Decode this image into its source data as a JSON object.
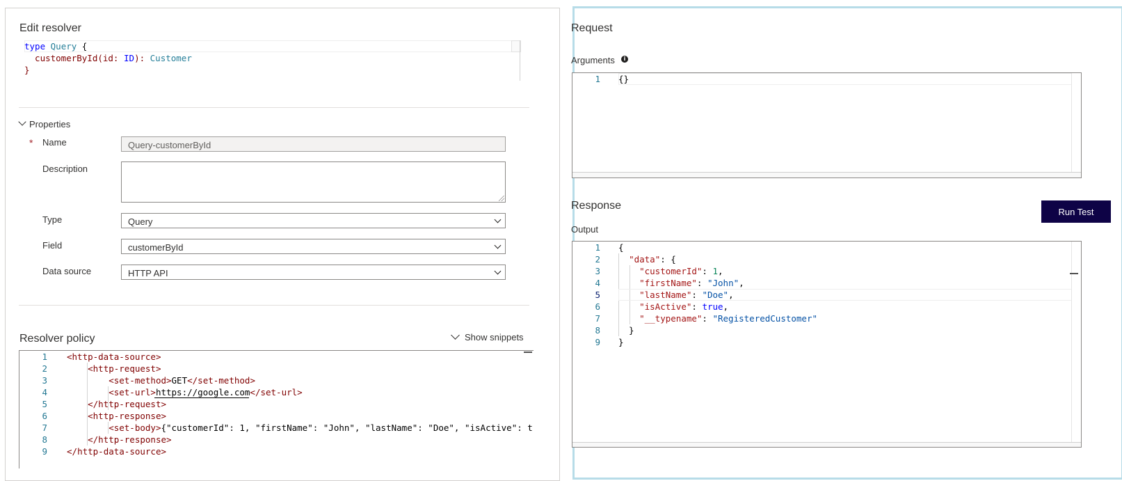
{
  "edit_resolver": {
    "title": "Edit resolver",
    "schema_lines": [
      [
        {
          "t": "type",
          "c": "kw"
        },
        {
          "t": " ",
          "c": "plain"
        },
        {
          "t": "Query",
          "c": "typ"
        },
        {
          "t": " {",
          "c": "plain"
        }
      ],
      [
        {
          "t": "  customerById(id: ",
          "c": "tag"
        },
        {
          "t": "ID",
          "c": "kw"
        },
        {
          "t": "): ",
          "c": "tag"
        },
        {
          "t": "Customer",
          "c": "typ"
        }
      ],
      [
        {
          "t": "}",
          "c": "tag"
        }
      ]
    ]
  },
  "properties": {
    "header": "Properties",
    "required_mark": "*",
    "name_label": "Name",
    "name_value": "Query-customerById",
    "description_label": "Description",
    "description_value": "",
    "type_label": "Type",
    "type_value": "Query",
    "field_label": "Field",
    "field_value": "customerById",
    "data_source_label": "Data source",
    "data_source_value": "HTTP API"
  },
  "resolver_policy": {
    "title": "Resolver policy",
    "show_snippets_label": "Show snippets",
    "lines": [
      {
        "n": "1",
        "tokens": [
          {
            "t": "<",
            "c": "tag"
          },
          {
            "t": "http-data-source",
            "c": "tag"
          },
          {
            "t": ">",
            "c": "tag"
          }
        ]
      },
      {
        "n": "2",
        "tokens": [
          {
            "t": "    <",
            "c": "tag"
          },
          {
            "t": "http-request",
            "c": "tag"
          },
          {
            "t": ">",
            "c": "tag"
          }
        ]
      },
      {
        "n": "3",
        "tokens": [
          {
            "t": "        <",
            "c": "tag"
          },
          {
            "t": "set-method",
            "c": "tag"
          },
          {
            "t": ">",
            "c": "tag"
          },
          {
            "t": "GET",
            "c": "plain"
          },
          {
            "t": "</",
            "c": "tag"
          },
          {
            "t": "set-method",
            "c": "tag"
          },
          {
            "t": ">",
            "c": "tag"
          }
        ]
      },
      {
        "n": "4",
        "tokens": [
          {
            "t": "        <",
            "c": "tag"
          },
          {
            "t": "set-url",
            "c": "tag"
          },
          {
            "t": ">",
            "c": "tag"
          },
          {
            "t": "https://google.com",
            "c": "plain"
          },
          {
            "t": "</",
            "c": "tag"
          },
          {
            "t": "set-url",
            "c": "tag"
          },
          {
            "t": ">",
            "c": "tag"
          }
        ]
      },
      {
        "n": "5",
        "tokens": [
          {
            "t": "    </",
            "c": "tag"
          },
          {
            "t": "http-request",
            "c": "tag"
          },
          {
            "t": ">",
            "c": "tag"
          }
        ]
      },
      {
        "n": "6",
        "tokens": [
          {
            "t": "    <",
            "c": "tag"
          },
          {
            "t": "http-response",
            "c": "tag"
          },
          {
            "t": ">",
            "c": "tag"
          }
        ]
      },
      {
        "n": "7",
        "tokens": [
          {
            "t": "        <",
            "c": "tag"
          },
          {
            "t": "set-body",
            "c": "tag"
          },
          {
            "t": ">",
            "c": "tag"
          },
          {
            "t": "{\"customerId\": 1, \"firstName\": \"John\", \"lastName\": \"Doe\", \"isActive\": tr",
            "c": "plain"
          }
        ]
      },
      {
        "n": "8",
        "tokens": [
          {
            "t": "    </",
            "c": "tag"
          },
          {
            "t": "http-response",
            "c": "tag"
          },
          {
            "t": ">",
            "c": "tag"
          }
        ]
      },
      {
        "n": "9",
        "tokens": [
          {
            "t": "</",
            "c": "tag"
          },
          {
            "t": "http-data-source",
            "c": "tag"
          },
          {
            "t": ">",
            "c": "tag"
          }
        ]
      }
    ]
  },
  "request": {
    "title": "Request",
    "arguments_label": "Arguments",
    "info_glyph": "i",
    "lines": [
      {
        "n": "1",
        "tokens": [
          {
            "t": "{}",
            "c": "plain"
          }
        ]
      }
    ]
  },
  "response": {
    "title": "Response",
    "run_test_label": "Run Test",
    "output_label": "Output",
    "lines": [
      {
        "n": "1",
        "tokens": [
          {
            "t": "{",
            "c": "plain"
          }
        ]
      },
      {
        "n": "2",
        "tokens": [
          {
            "t": "  ",
            "c": "plain"
          },
          {
            "t": "\"data\"",
            "c": "key"
          },
          {
            "t": ": {",
            "c": "plain"
          }
        ]
      },
      {
        "n": "3",
        "tokens": [
          {
            "t": "    ",
            "c": "plain"
          },
          {
            "t": "\"customerId\"",
            "c": "key"
          },
          {
            "t": ": ",
            "c": "plain"
          },
          {
            "t": "1",
            "c": "num"
          },
          {
            "t": ",",
            "c": "plain"
          }
        ]
      },
      {
        "n": "4",
        "tokens": [
          {
            "t": "    ",
            "c": "plain"
          },
          {
            "t": "\"firstName\"",
            "c": "key"
          },
          {
            "t": ": ",
            "c": "plain"
          },
          {
            "t": "\"John\"",
            "c": "str"
          },
          {
            "t": ",",
            "c": "plain"
          }
        ]
      },
      {
        "n": "5",
        "tokens": [
          {
            "t": "    ",
            "c": "plain"
          },
          {
            "t": "\"lastName\"",
            "c": "key"
          },
          {
            "t": ": ",
            "c": "plain"
          },
          {
            "t": "\"Doe\"",
            "c": "str"
          },
          {
            "t": ",",
            "c": "plain"
          }
        ]
      },
      {
        "n": "6",
        "tokens": [
          {
            "t": "    ",
            "c": "plain"
          },
          {
            "t": "\"isActive\"",
            "c": "key"
          },
          {
            "t": ": ",
            "c": "plain"
          },
          {
            "t": "true",
            "c": "kw"
          },
          {
            "t": ",",
            "c": "plain"
          }
        ]
      },
      {
        "n": "7",
        "tokens": [
          {
            "t": "    ",
            "c": "plain"
          },
          {
            "t": "\"__typename\"",
            "c": "key"
          },
          {
            "t": ": ",
            "c": "plain"
          },
          {
            "t": "\"RegisteredCustomer\"",
            "c": "str"
          }
        ]
      },
      {
        "n": "8",
        "tokens": [
          {
            "t": "  }",
            "c": "plain"
          }
        ]
      },
      {
        "n": "9",
        "tokens": [
          {
            "t": "}",
            "c": "plain"
          }
        ]
      }
    ]
  },
  "colors": {
    "accent_border": "#b7dce8",
    "run_button": "#0e0346",
    "line_number": "#237893",
    "xml_tag": "#800000",
    "json_key": "#a31515",
    "json_string": "#0451a5",
    "keyword": "#0000ff",
    "type_name": "#267f99",
    "number": "#098658",
    "required": "#a4262c"
  }
}
